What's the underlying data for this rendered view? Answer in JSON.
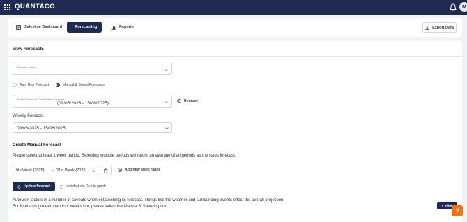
{
  "app": {
    "brand": "QUANTACO.",
    "avatar_initial": "M"
  },
  "tabs": [
    {
      "label": "Salesline Dashboard",
      "icon": "dashboard-icon",
      "active": false
    },
    {
      "label": "Forecasting",
      "icon": "clock-icon",
      "active": true
    },
    {
      "label": "Reports",
      "icon": "bar-chart-icon",
      "active": false
    }
  ],
  "export_label": "Export Data",
  "view": {
    "title": "View Forecasts",
    "venue_label": "Select a venue",
    "radio_auto": "Auto Gen Forecast",
    "radio_manual": "Manual & Saved Forecasts",
    "radio_selected": "manual",
    "saved_label": "Select Saved or Create New Forecast",
    "saved_value": "(09/06/2025 - 15/06/2025)",
    "remove_label": "Remove",
    "weekly_label": "Weekly Forecast",
    "weekly_value": "09/06/2025 - 15/06/2025"
  },
  "manual": {
    "title": "Create Manual Forecast",
    "instruction": "Please select at least 1 week period. Selecting multiple periods will return an average of all periods as the sales forecast.",
    "week_start": "9th Week (2025)",
    "week_sep": "-",
    "week_end": "21st Week (2025)",
    "add_range_label": "Add new week range",
    "update_label": "Update forecast",
    "include_autogen_label": "Include Auto Gen in graph",
    "note_line1": "AutoGen factors in a number of caveats when establishing its forecast. Things like the weather and surrounding events effect the overall projection.",
    "note_line2": "For forecasts greater than four weeks out, please select the Manual & Saved option.",
    "filter_label": "Filter",
    "help_label": "?"
  },
  "colors": {
    "navy": "#1e2a4f",
    "accent_orange": "#f97316"
  }
}
